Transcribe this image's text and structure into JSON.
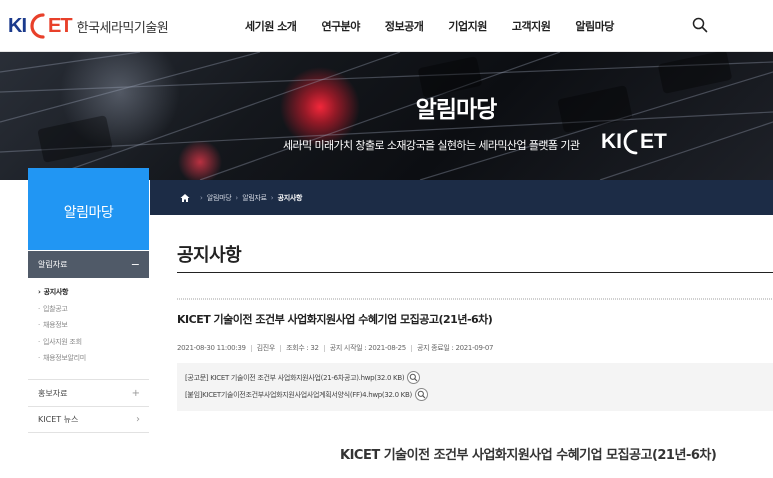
{
  "header": {
    "logo_ki": "KI",
    "logo_et": "ET",
    "org_name": "한국세라믹기술원",
    "nav": [
      "세기원 소개",
      "연구분야",
      "정보공개",
      "기업지원",
      "고객지원",
      "알림마당"
    ]
  },
  "banner": {
    "title": "알림마당",
    "subtitle": "세라믹 미래가치 창출로 소재강국을 실현하는 세라믹산업 플랫폼 기관",
    "logo_ki": "KI",
    "logo_et": "ET"
  },
  "breadcrumb": {
    "items": [
      "알림마당",
      "알림자료",
      "공지사항"
    ]
  },
  "sidebar": {
    "title": "알림마당",
    "group_label": "알림자료",
    "sub_items": [
      "공지사항",
      "입찰공고",
      "채용정보",
      "입사지원 조회",
      "채용정보알리미"
    ],
    "menus": [
      {
        "label": "홍보자료",
        "icon": "+"
      },
      {
        "label": "KICET 뉴스",
        "icon": "›"
      }
    ]
  },
  "content": {
    "page_title": "공지사항",
    "post_title": "KICET 기술이전 조건부 사업화지원사업 수혜기업 모집공고(21년-6차)",
    "meta": [
      "2021-08-30 11:00:39",
      "김진우",
      "조회수 : 32",
      "공지 시작일 : 2021-08-25",
      "공지 종료일 : 2021-09-07"
    ],
    "attachments": [
      "[공고문] KICET 기술이전 조건부 사업화지원사업(21-6차공고).hwp(32.0 KB)",
      "[붙임]KICET기술이전조건부사업화지원사업사업계획서양식(FF)4.hwp(32.0 KB)"
    ],
    "body_heading": "KICET 기술이전 조건부 사업화지원사업 수혜기업 모집공고(21년-6차)"
  },
  "colors": {
    "accent": "#2196f3",
    "nav_dark": "#1c2c46",
    "logo_blue": "#1b3a8c",
    "logo_red": "#e8402a"
  }
}
